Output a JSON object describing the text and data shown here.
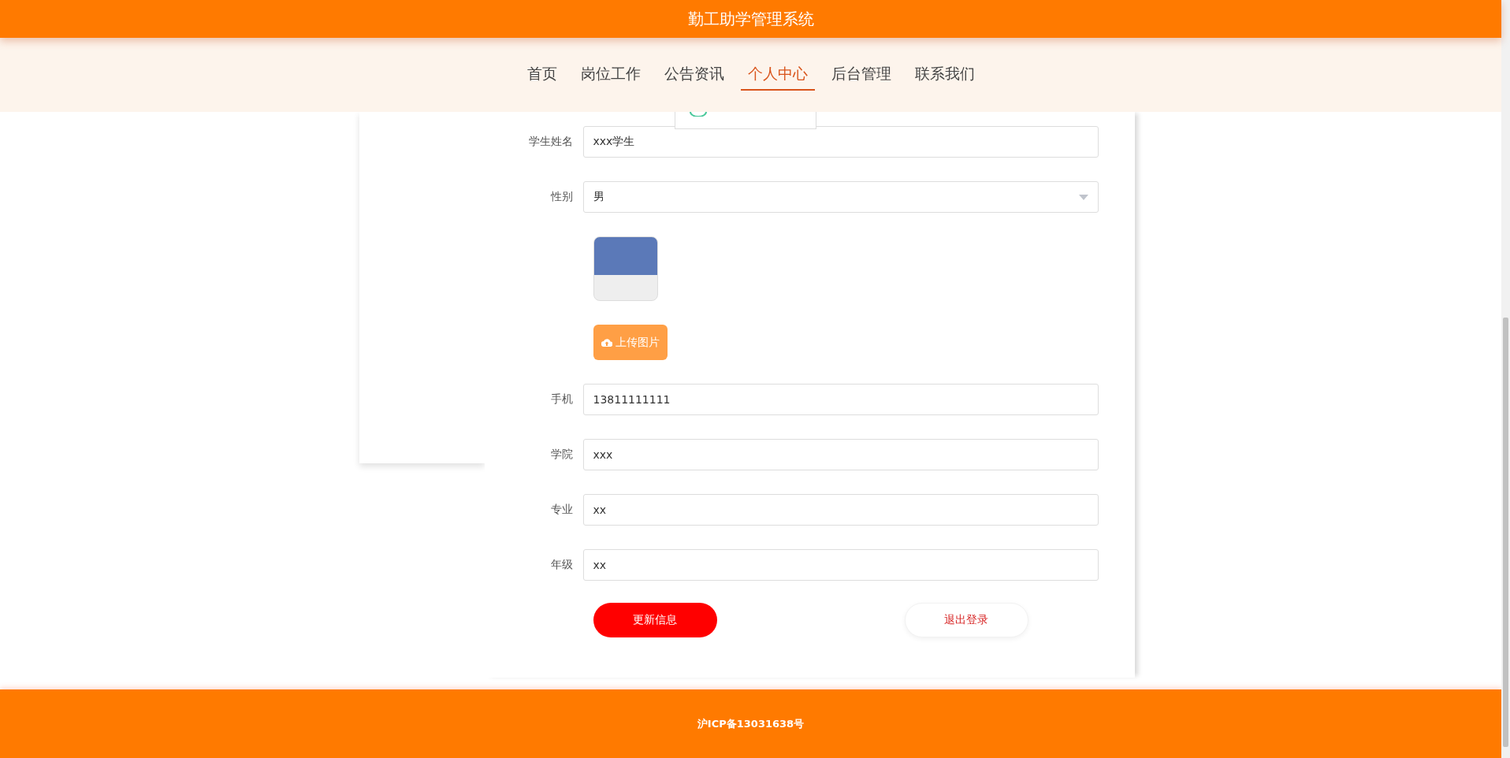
{
  "header": {
    "title": "勤工助学管理系统"
  },
  "nav": [
    {
      "label": "首页",
      "selected": false
    },
    {
      "label": "岗位工作",
      "selected": false
    },
    {
      "label": "公告资讯",
      "selected": false
    },
    {
      "label": "个人中心",
      "selected": true
    },
    {
      "label": "后台管理",
      "selected": false
    },
    {
      "label": "联系我们",
      "selected": false
    }
  ],
  "form": {
    "fields": [
      {
        "kind": "text",
        "label": "学生姓名",
        "value": "xxx学生"
      },
      {
        "kind": "select",
        "label": "性别",
        "value": "男"
      },
      {
        "kind": "photo"
      },
      {
        "kind": "upload",
        "label": "上传图片"
      },
      {
        "kind": "text",
        "label": "手机",
        "value": "13811111111"
      },
      {
        "kind": "text",
        "label": "学院",
        "value": "xxx"
      },
      {
        "kind": "text",
        "label": "专业",
        "value": "xx"
      },
      {
        "kind": "text",
        "label": "年级",
        "value": "xx"
      }
    ],
    "buttons": [
      {
        "label": "更新信息",
        "kind": "primary"
      },
      {
        "label": "退出登录",
        "kind": "secondary"
      }
    ]
  },
  "footer": {
    "text": "沪ICP备13031638号"
  }
}
